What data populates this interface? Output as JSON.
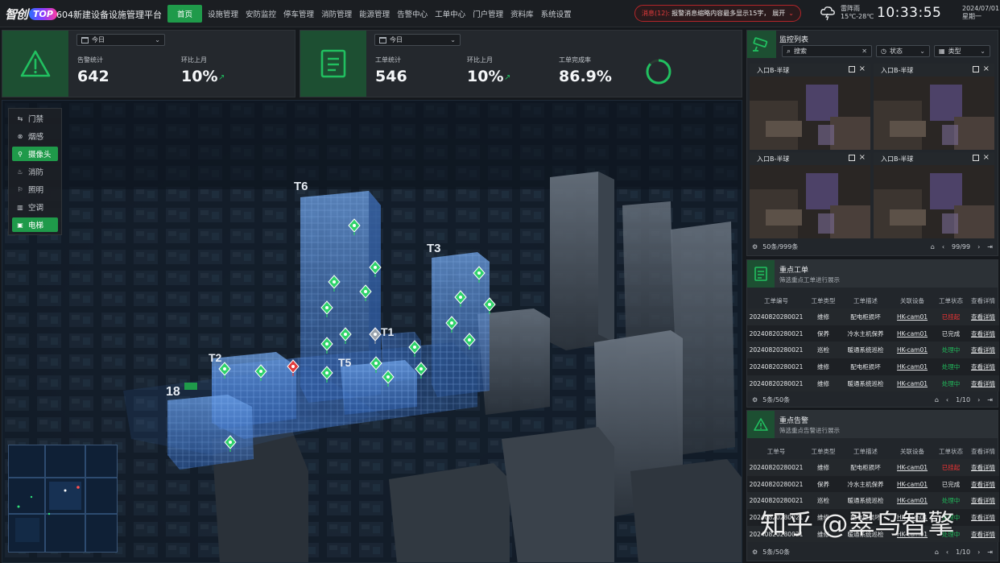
{
  "topbar": {
    "logo_text": "智创",
    "logo_badge": "TOP",
    "app_title": "604新建设备设施管理平台",
    "nav": [
      "首页",
      "设施管理",
      "安防监控",
      "停车管理",
      "消防管理",
      "能源管理",
      "告警中心",
      "工单中心",
      "门户管理",
      "资料库",
      "系统设置"
    ],
    "alert_prefix": "消息(12):",
    "alert_text": "报警消息缩略内容最多显示15字，",
    "alert_expand": "展开",
    "weather_label": "雷阵雨",
    "weather_temp": "15℃-28℃",
    "time": "10:33:55",
    "date": "2024/07/01",
    "weekday": "星期一"
  },
  "alarm_card": {
    "filter": "今日",
    "stat_label": "告警统计",
    "stat_value": "642",
    "mom_label": "环比上月",
    "mom_value": "10%"
  },
  "order_card": {
    "filter": "今日",
    "stat_label": "工单统计",
    "stat_value": "546",
    "mom_label": "环比上月",
    "mom_value": "10%",
    "rate_label": "工单完成率",
    "rate_value": "86.9%",
    "rate_fraction": 0.869
  },
  "layers": [
    {
      "icon": "⇆",
      "label": "门禁"
    },
    {
      "icon": "⊗",
      "label": "烟感"
    },
    {
      "icon": "⚲",
      "label": "摄像头"
    },
    {
      "icon": "♨",
      "label": "消防"
    },
    {
      "icon": "⚐",
      "label": "照明"
    },
    {
      "icon": "▥",
      "label": "空调"
    },
    {
      "icon": "▣",
      "label": "电梯"
    }
  ],
  "buildings": {
    "t6": "T6",
    "t3": "T3",
    "t1": "T1",
    "t2": "T2",
    "t5": "T5",
    "b18": "18"
  },
  "monitor": {
    "title": "监控列表",
    "search_placeholder": "搜索",
    "status_filter": "状态",
    "type_filter": "类型",
    "cameras": [
      {
        "name": "入口B-半球"
      },
      {
        "name": "入口B-半球"
      },
      {
        "name": "入口B-半球"
      },
      {
        "name": "入口B-半球"
      }
    ],
    "count": "50条/999条",
    "page": "99/99"
  },
  "orders": {
    "title": "重点工单",
    "subtitle": "筛选重点工单进行展示",
    "headers": [
      "工单编号",
      "工单类型",
      "工单描述",
      "关联设备",
      "工单状态",
      "查看详情"
    ],
    "rows": [
      [
        "20240820280021",
        "维修",
        "配电柜损坏",
        "HK-cam01",
        "已挂起",
        "查看详情"
      ],
      [
        "20240820280021",
        "保养",
        "冷水主机保养",
        "HK-cam01",
        "已完成",
        "查看详情"
      ],
      [
        "20240820280021",
        "巡检",
        "暖通系统巡检",
        "HK-cam01",
        "处理中",
        "查看详情"
      ],
      [
        "20240820280021",
        "维修",
        "配电柜损坏",
        "HK-cam01",
        "处理中",
        "查看详情"
      ],
      [
        "20240820280021",
        "维修",
        "暖通系统巡检",
        "HK-cam01",
        "处理中",
        "查看详情"
      ]
    ],
    "count": "5条/50条",
    "page": "1/10"
  },
  "alarms": {
    "title": "重点告警",
    "subtitle": "筛选重点告警进行展示",
    "headers": [
      "工单号",
      "工单类型",
      "工单描述",
      "关联设备",
      "工单状态",
      "查看详情"
    ],
    "rows": [
      [
        "20240820280021",
        "维修",
        "配电柜损坏",
        "HK-cam01",
        "已挂起",
        "查看详情"
      ],
      [
        "20240820280021",
        "保养",
        "冷水主机保养",
        "HK-cam01",
        "已完成",
        "查看详情"
      ],
      [
        "20240820280021",
        "巡检",
        "暖通系统巡检",
        "HK-cam01",
        "处理中",
        "查看详情"
      ],
      [
        "20240820280021",
        "维修",
        "配电柜损坏",
        "HK-cam01",
        "处理中",
        "查看详情"
      ],
      [
        "20240820280021",
        "维修",
        "暖通系统巡检",
        "HK-cam01",
        "处理中",
        "查看详情"
      ]
    ],
    "count": "5条/50条",
    "page": "1/10"
  },
  "status_colors": {
    "已挂起": "#ff3535",
    "已完成": "#e4e6e8",
    "处理中": "#21b85b"
  },
  "accent_color": "#1f9a4a",
  "watermark": "知乎 @翠鸟智擎"
}
